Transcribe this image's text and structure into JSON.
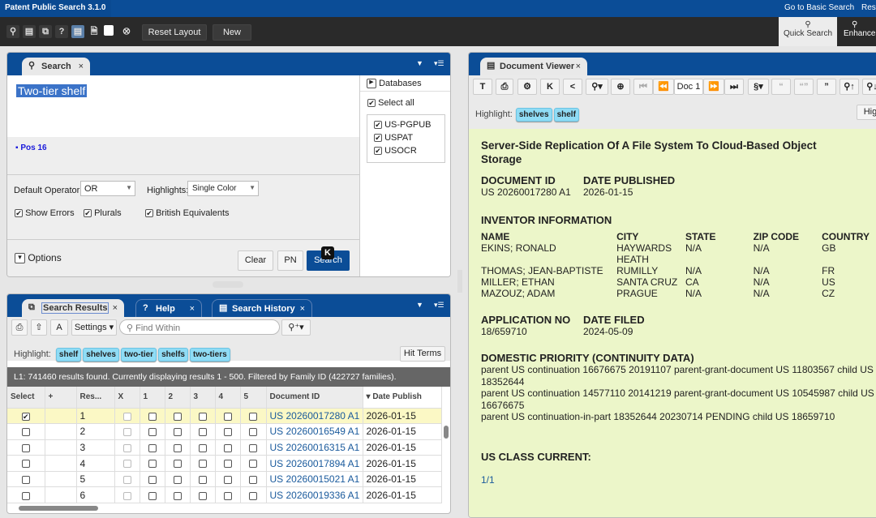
{
  "app": {
    "title": "Patent Public Search 3.1.0",
    "links": [
      "Go to Basic Search",
      "Res"
    ]
  },
  "toolbar": {
    "reset_layout": "Reset Layout",
    "new": "New",
    "quick_search": "Quick Search",
    "enhanced": "Enhance"
  },
  "search": {
    "tab": "Search",
    "query": "Two-tier shelf",
    "pos": "Pos 16",
    "databases_label": "Databases",
    "select_all": "Select all",
    "databases": [
      "US-PGPUB",
      "USPAT",
      "USOCR"
    ],
    "default_operator_label": "Default Operator:",
    "default_operator": "OR",
    "highlights_label": "Highlights:",
    "highlights": "Single Color",
    "show_errors": "Show Errors",
    "plurals": "Plurals",
    "british": "British Equivalents",
    "options": "Options",
    "clear": "Clear",
    "pn": "PN",
    "search_btn": "Search",
    "kbd_badge": "K"
  },
  "results": {
    "tabs": [
      "Search Results",
      "Help",
      "Search History"
    ],
    "settings": "Settings",
    "find_placeholder": "Find Within",
    "highlight_label": "Highlight:",
    "highlights": [
      "shelf",
      "shelves",
      "two-tier",
      "shelfs",
      "two-tiers"
    ],
    "hit_terms": "Hit Terms",
    "status": "L1: 741460 results found. Currently displaying results 1 - 500. Filtered by Family ID (422727 families).",
    "columns": [
      "Select",
      "+",
      "Res...",
      "X",
      "1",
      "2",
      "3",
      "4",
      "5",
      "Document ID",
      "Date Publish"
    ],
    "rows": [
      {
        "n": "1",
        "id": "US 20260017280 A1",
        "date": "2026-01-15",
        "selected": true
      },
      {
        "n": "2",
        "id": "US 20260016549 A1",
        "date": "2026-01-15",
        "selected": false
      },
      {
        "n": "3",
        "id": "US 20260016315 A1",
        "date": "2026-01-15",
        "selected": false
      },
      {
        "n": "4",
        "id": "US 20260017894 A1",
        "date": "2026-01-15",
        "selected": false
      },
      {
        "n": "5",
        "id": "US 20260015021 A1",
        "date": "2026-01-15",
        "selected": false
      },
      {
        "n": "6",
        "id": "US 20260019336 A1",
        "date": "2026-01-15",
        "selected": false
      }
    ]
  },
  "viewer": {
    "tab": "Document Viewer",
    "doc_nav": "Doc 1",
    "highlight_label": "Highlight:",
    "highlights": [
      "shelves",
      "shelf"
    ],
    "high_btn": "High",
    "title": "Server-Side Replication Of A File System To Cloud-Based Object Storage",
    "doc_id_label": "DOCUMENT ID",
    "doc_id": "US 20260017280 A1",
    "date_pub_label": "DATE PUBLISHED",
    "date_pub": "2026-01-15",
    "inventor_heading": "INVENTOR INFORMATION",
    "inv_cols": [
      "NAME",
      "CITY",
      "STATE",
      "ZIP CODE",
      "COUNTRY"
    ],
    "inventors": [
      [
        "EKINS; RONALD",
        "HAYWARDS HEATH",
        "N/A",
        "N/A",
        "GB"
      ],
      [
        "THOMAS; JEAN-BAPTISTE",
        "RUMILLY",
        "N/A",
        "N/A",
        "FR"
      ],
      [
        "MILLER; ETHAN",
        "SANTA CRUZ",
        "CA",
        "N/A",
        "US"
      ],
      [
        "MAZOUZ; ADAM",
        "PRAGUE",
        "N/A",
        "N/A",
        "CZ"
      ]
    ],
    "app_no_label": "APPLICATION NO",
    "app_no": "18/659710",
    "date_filed_label": "DATE FILED",
    "date_filed": "2024-05-09",
    "priority_heading": "DOMESTIC PRIORITY (CONTINUITY DATA)",
    "priority": [
      "parent US continuation 16676675 20191107 parent-grant-document US 11803567 child US 18352644",
      "parent US continuation 14577110 20141219 parent-grant-document US 10545987 child US 16676675",
      "parent US continuation-in-part 18352644 20230714 PENDING child US 18659710"
    ],
    "class_heading": "US CLASS CURRENT:",
    "pager": "1/1"
  }
}
